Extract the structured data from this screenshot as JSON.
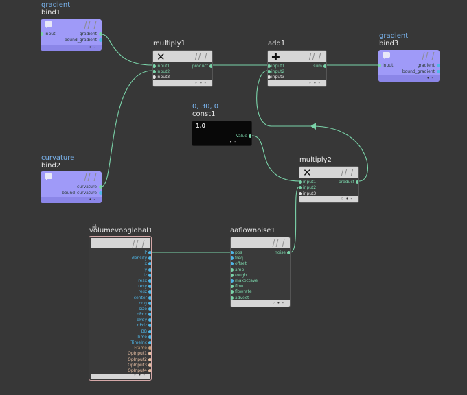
{
  "nodes": {
    "bind1": {
      "sub": "gradient",
      "title": "bind1",
      "in": [
        "input"
      ],
      "out": [
        "gradient",
        "bound_gradient"
      ]
    },
    "bind2": {
      "sub": "curvature",
      "title": "bind2",
      "out": [
        "curvature",
        "bound_curvature"
      ]
    },
    "bind3": {
      "sub": "gradient",
      "title": "bind3",
      "in": [
        "input"
      ],
      "out": [
        "gradient",
        "bound_gradient"
      ]
    },
    "multiply1": {
      "title": "multiply1",
      "icon": "✕",
      "in": [
        "input1",
        "input2",
        "input3"
      ],
      "out": [
        "product"
      ]
    },
    "add1": {
      "title": "add1",
      "icon": "✚",
      "in": [
        "input1",
        "input2",
        "input3"
      ],
      "out": [
        "sum"
      ]
    },
    "const1": {
      "sub": "0, 30, 0",
      "title": "const1",
      "icon": "1.0",
      "out": [
        "Value"
      ]
    },
    "multiply2": {
      "title": "multiply2",
      "icon": "✕",
      "in": [
        "input1",
        "input2",
        "input3"
      ],
      "out": [
        "product"
      ]
    },
    "aaflownoise1": {
      "title": "aaflownoise1",
      "in": [
        "pos",
        "freq",
        "offset",
        "amp",
        "rough",
        "maxoctave",
        "flow",
        "flowrate",
        "advect"
      ],
      "out": [
        "noise"
      ]
    },
    "volumevopglobal1": {
      "title": "volumevopglobal1",
      "out": [
        "P",
        "density",
        "ix",
        "iy",
        "iz",
        "resx",
        "resy",
        "resz",
        "center",
        "orig",
        "size",
        "dPdx",
        "dPdy",
        "dPdz",
        "BB",
        "Time",
        "TimeInc",
        "Frame",
        "OpInput1",
        "OpInput2",
        "OpInput3",
        "OpInput4"
      ]
    }
  },
  "colors": {
    "background": "#373737",
    "bind_node": "#9f9af8",
    "wire": "#7ad3a9",
    "float_port": "#7ad3a9",
    "vector_port": "#4fb7e8",
    "int_port": "#c8a07a",
    "string_port": "#e0e0e0",
    "label_blue": "#7ab4ee",
    "locked_border": "#d4a7a7"
  }
}
